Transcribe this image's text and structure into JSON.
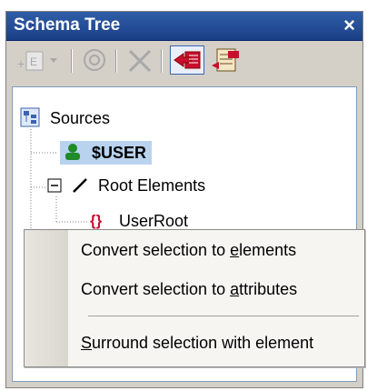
{
  "window": {
    "title": "Schema Tree",
    "close_symbol": "×"
  },
  "toolbar": {
    "buttons": [
      {
        "name": "add-element-button",
        "icon": "add-element-icon",
        "label": "E",
        "enabled": false
      },
      {
        "name": "target-button",
        "icon": "target-icon",
        "enabled": false
      },
      {
        "name": "delete-button",
        "icon": "delete-icon",
        "enabled": false
      },
      {
        "name": "import-button",
        "icon": "import-icon",
        "enabled": true
      },
      {
        "name": "properties-button",
        "icon": "properties-icon",
        "enabled": true
      }
    ]
  },
  "tree": {
    "root": "Sources",
    "user": "$USER",
    "root_elements": "Root Elements",
    "user_root": "UserRoot"
  },
  "context_menu": {
    "items": [
      {
        "prefix": "Convert selection to ",
        "mnemonic": "e",
        "suffix": "lements"
      },
      {
        "prefix": "Convert selection to ",
        "mnemonic": "a",
        "suffix": "ttributes"
      },
      {
        "prefix": "",
        "mnemonic": "S",
        "suffix": "urround selection with element"
      }
    ]
  },
  "colors": {
    "titlebar": "#1b3f86",
    "selection": "#b9d3ef",
    "accent_red": "#c8102e",
    "user_green": "#1f8a2a"
  }
}
